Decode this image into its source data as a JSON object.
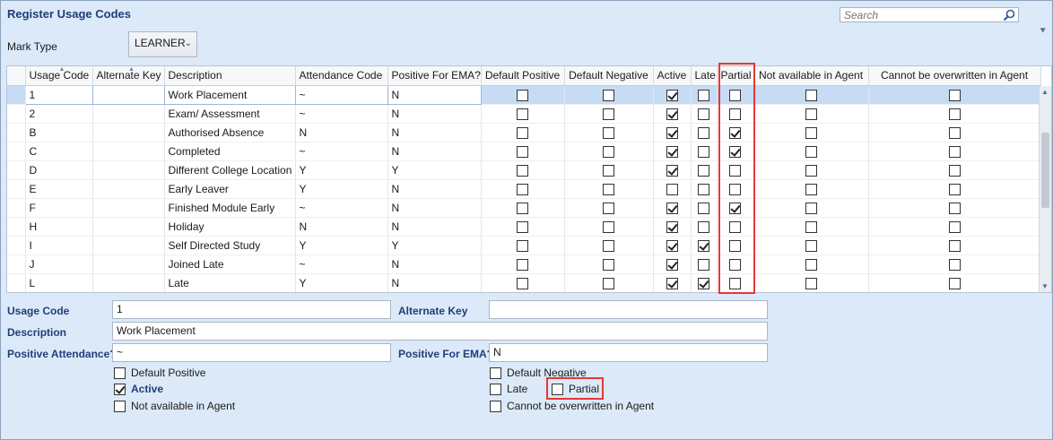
{
  "window": {
    "title": "Register Usage Codes"
  },
  "search": {
    "placeholder": "Search"
  },
  "mark_type": {
    "label": "Mark Type",
    "value": "LEARNER"
  },
  "grid": {
    "columns": [
      "Usage Code",
      "Alternate Key",
      "Description",
      "Attendance Code",
      "Positive For EMA?",
      "Default Positive",
      "Default Negative",
      "Active",
      "Late",
      "Partial",
      "Not available in Agent",
      "Cannot be overwritten in Agent"
    ],
    "rows": [
      {
        "code": "1",
        "alt": "",
        "desc": "Work Placement",
        "att": "~",
        "ema": "N",
        "dpos": false,
        "dneg": false,
        "active": true,
        "late": false,
        "partial": false,
        "notagent": false,
        "noover": false
      },
      {
        "code": "2",
        "alt": "",
        "desc": "Exam/ Assessment",
        "att": "~",
        "ema": "N",
        "dpos": false,
        "dneg": false,
        "active": true,
        "late": false,
        "partial": false,
        "notagent": false,
        "noover": false
      },
      {
        "code": "B",
        "alt": "",
        "desc": "Authorised Absence",
        "att": "N",
        "ema": "N",
        "dpos": false,
        "dneg": false,
        "active": true,
        "late": false,
        "partial": true,
        "notagent": false,
        "noover": false
      },
      {
        "code": "C",
        "alt": "",
        "desc": "Completed",
        "att": "~",
        "ema": "N",
        "dpos": false,
        "dneg": false,
        "active": true,
        "late": false,
        "partial": true,
        "notagent": false,
        "noover": false
      },
      {
        "code": "D",
        "alt": "",
        "desc": "Different College Location",
        "att": "Y",
        "ema": "Y",
        "dpos": false,
        "dneg": false,
        "active": true,
        "late": false,
        "partial": false,
        "notagent": false,
        "noover": false
      },
      {
        "code": "E",
        "alt": "",
        "desc": "Early Leaver",
        "att": "Y",
        "ema": "N",
        "dpos": false,
        "dneg": false,
        "active": false,
        "late": false,
        "partial": false,
        "notagent": false,
        "noover": false
      },
      {
        "code": "F",
        "alt": "",
        "desc": "Finished Module Early",
        "att": "~",
        "ema": "N",
        "dpos": false,
        "dneg": false,
        "active": true,
        "late": false,
        "partial": true,
        "notagent": false,
        "noover": false
      },
      {
        "code": "H",
        "alt": "",
        "desc": "Holiday",
        "att": "N",
        "ema": "N",
        "dpos": false,
        "dneg": false,
        "active": true,
        "late": false,
        "partial": false,
        "notagent": false,
        "noover": false
      },
      {
        "code": "I",
        "alt": "",
        "desc": "Self Directed Study",
        "att": "Y",
        "ema": "Y",
        "dpos": false,
        "dneg": false,
        "active": true,
        "late": true,
        "partial": false,
        "notagent": false,
        "noover": false
      },
      {
        "code": "J",
        "alt": "",
        "desc": "Joined Late",
        "att": "~",
        "ema": "N",
        "dpos": false,
        "dneg": false,
        "active": true,
        "late": false,
        "partial": false,
        "notagent": false,
        "noover": false
      },
      {
        "code": "L",
        "alt": "",
        "desc": "Late",
        "att": "Y",
        "ema": "N",
        "dpos": false,
        "dneg": false,
        "active": true,
        "late": true,
        "partial": false,
        "notagent": false,
        "noover": false
      }
    ]
  },
  "detail": {
    "usage_code_label": "Usage Code",
    "usage_code_value": "1",
    "alt_key_label": "Alternate Key",
    "alt_key_value": "",
    "description_label": "Description",
    "description_value": "Work Placement",
    "pos_att_label": "Positive Attendance?",
    "pos_att_value": "~",
    "pos_ema_label": "Positive For EMA?",
    "pos_ema_value": "N",
    "default_positive": "Default Positive",
    "active": "Active",
    "not_available": "Not available in Agent",
    "default_negative": "Default Negative",
    "late": "Late",
    "partial": "Partial",
    "cannot_overwrite": "Cannot be overwritten in Agent"
  }
}
